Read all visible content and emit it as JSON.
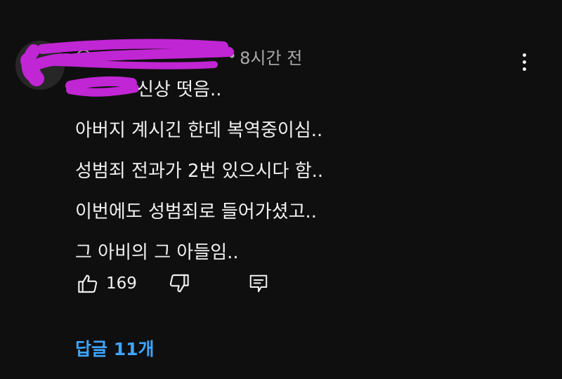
{
  "comment": {
    "author": "@",
    "separator": "•",
    "timestamp": "8시간 전",
    "text_lines": [
      "신상 떳음..",
      "아버지 계시긴 한데 복역중이심..",
      "성범죄 전과가 2번 있으시다 함..",
      "이번에도 성범죄로 들어가셨고..",
      "그 아비의 그 아들임.."
    ],
    "like_count": "169",
    "replies_label": "답글 11개"
  },
  "icons": {
    "more": "more-vert-icon",
    "like": "thumb-up-icon",
    "dislike": "thumb-down-icon",
    "reply": "reply-comment-icon"
  },
  "colors": {
    "background": "#0f0f0f",
    "text": "#f1f1f1",
    "secondary_text": "#aaaaaa",
    "link": "#3ea6ff",
    "redaction": "#c026d3"
  }
}
